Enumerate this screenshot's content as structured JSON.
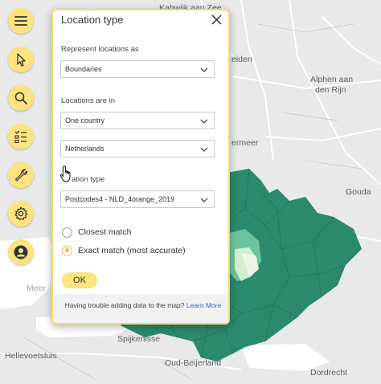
{
  "map": {
    "labels": [
      "Kahwijk aan Zee",
      "eiden",
      "Alphen aan",
      "den Rijn",
      "ermeer",
      "Gouda",
      "Meer",
      "Hellevoetsluis",
      "Spijkenisse",
      "Oud-Beijerland",
      "Dordrecht"
    ],
    "colors": {
      "land": "#e9e9e9",
      "water": "#ffffff",
      "region": "#2b8a6e",
      "region_light": "#6cc39f",
      "region_lighter": "#d3eecf"
    }
  },
  "toolbar": {
    "items": [
      {
        "icon": "hamburger-menu-icon"
      },
      {
        "icon": "pointer-icon"
      },
      {
        "icon": "search-icon"
      },
      {
        "icon": "layer-list-icon"
      },
      {
        "icon": "wrench-icon"
      },
      {
        "icon": "settings-gear-icon"
      },
      {
        "icon": "user-icon"
      }
    ],
    "accent": "#fde37e"
  },
  "panel": {
    "title": "Location type",
    "represent_label": "Represent locations as",
    "represent_value": "Boundaries",
    "locations_in_label": "Locations are in",
    "scope_value": "One country",
    "country_value": "Netherlands",
    "location_type_label": "ation type",
    "location_type_value": "Postcodes4 - NLD_4orange_2019",
    "radio_closest": "Closest match",
    "radio_exact": "Exact match (most accurate)",
    "selected_radio": "exact",
    "ok_label": "OK",
    "help_text": "Having trouble adding data to the map? ",
    "help_link": "Learn More"
  }
}
